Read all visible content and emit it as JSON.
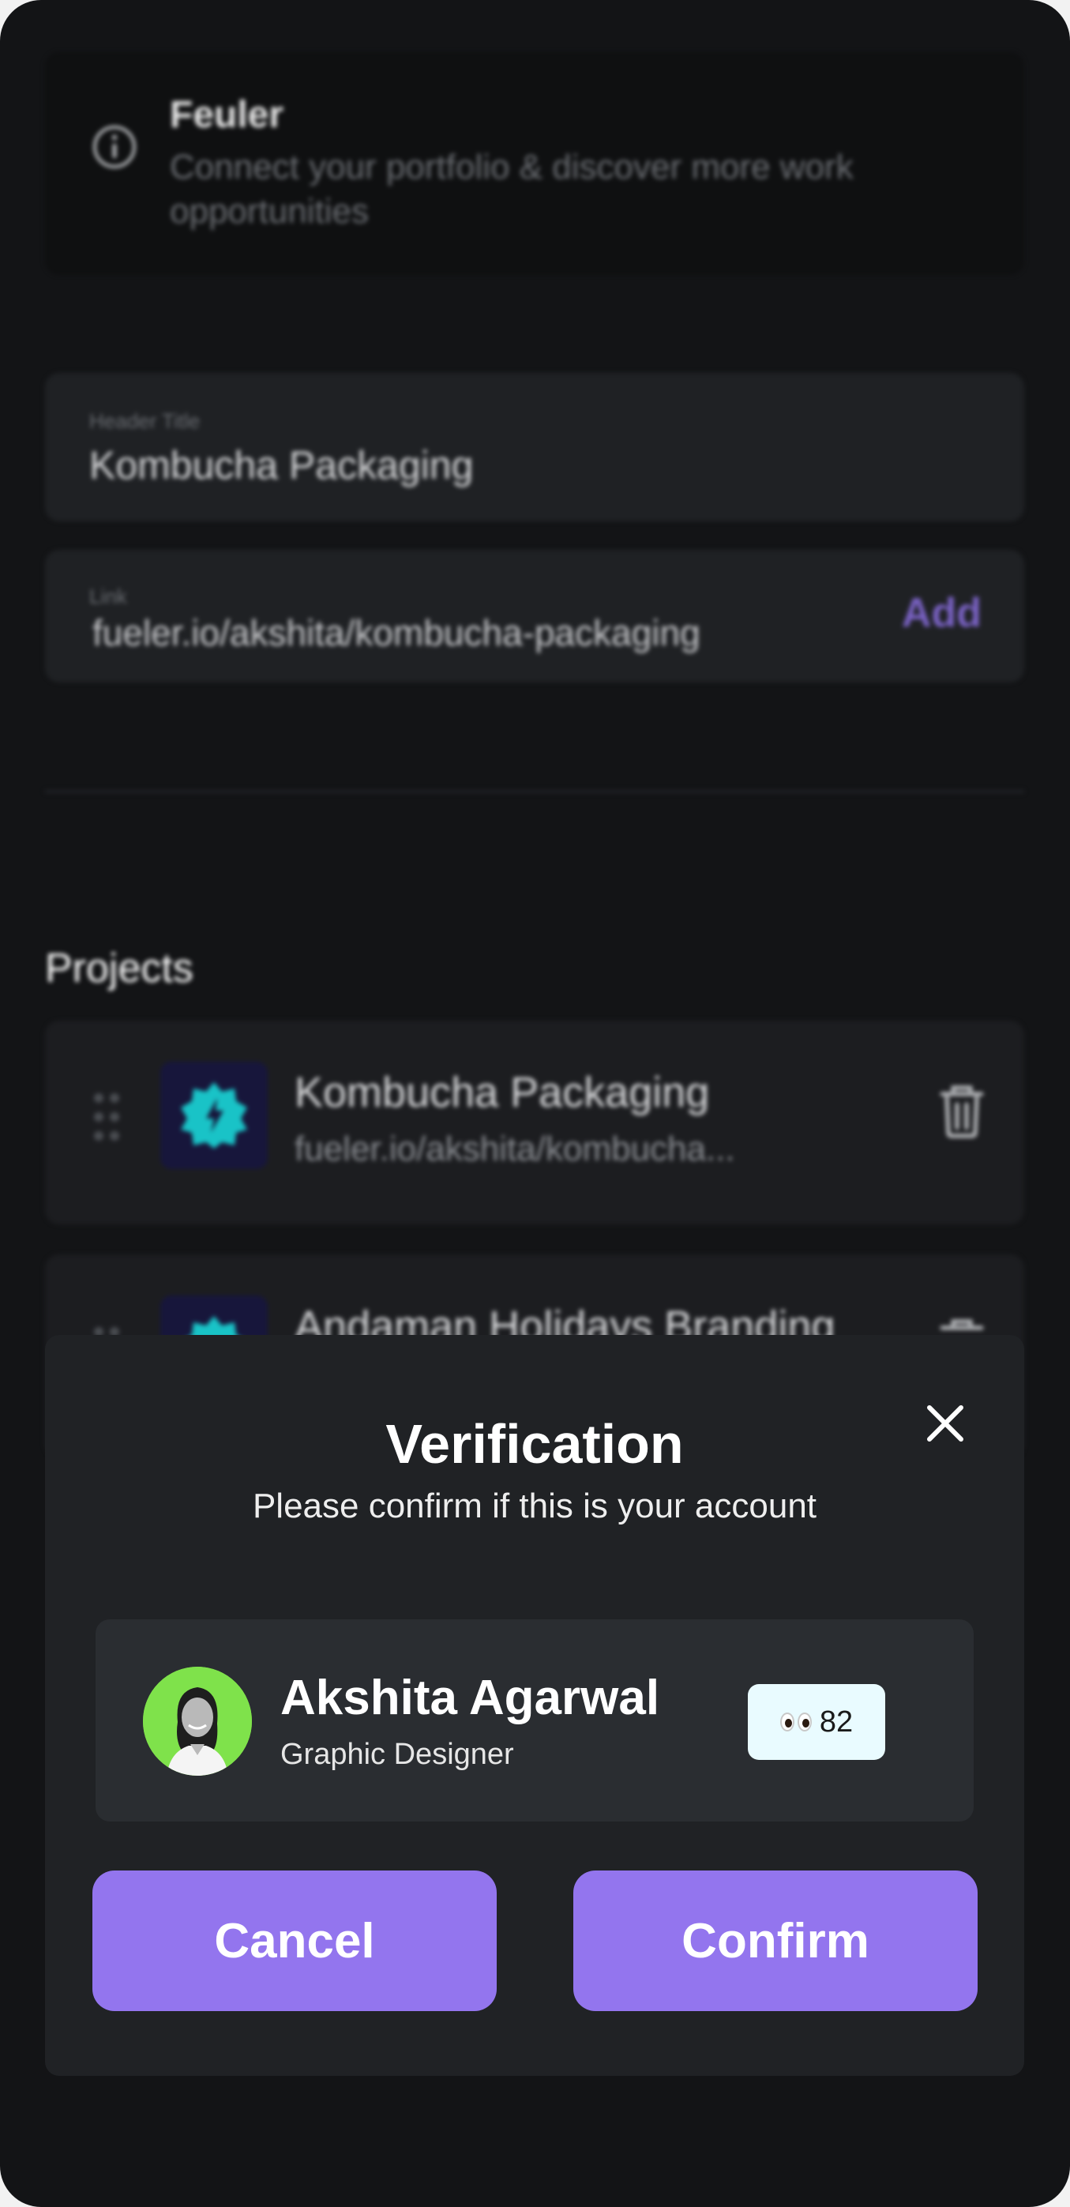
{
  "banner": {
    "title": "Feuler",
    "description": "Connect your portfolio & discover more work opportunities",
    "icon": "info-icon"
  },
  "form": {
    "header_title_label": "Header Title",
    "header_title_value": "Kombucha Packaging",
    "link_label": "Link",
    "link_value": "fueler.io/akshita/kombucha-packaging",
    "add_label": "Add"
  },
  "projects": {
    "label": "Projects",
    "items": [
      {
        "name": "Kombucha Packaging",
        "link": "fueler.io/akshita/kombucha..."
      },
      {
        "name": "Andaman Holidays Branding",
        "link": ""
      }
    ]
  },
  "modal": {
    "title": "Verification",
    "subtitle": "Please confirm if this is your account",
    "account": {
      "name": "Akshita Agarwal",
      "role": "Graphic Designer",
      "views": "82"
    },
    "cancel_label": "Cancel",
    "confirm_label": "Confirm"
  },
  "colors": {
    "accent": "#9375ee",
    "background": "#131416",
    "modal": "#202225",
    "badge": "#e9fbff",
    "avatar_bg": "#7fe24b"
  }
}
